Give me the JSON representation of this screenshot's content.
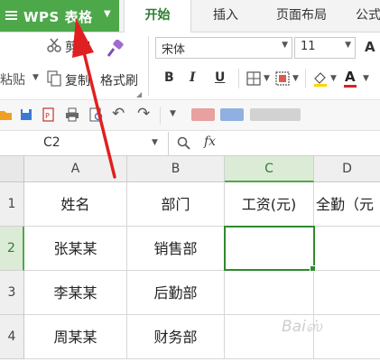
{
  "app": {
    "title": "WPS 表格"
  },
  "tabs": [
    "开始",
    "插入",
    "页面布局",
    "公式"
  ],
  "ribbon": {
    "cut": "剪切",
    "paste": "粘贴",
    "copy": "复制",
    "format_painter": "格式刷",
    "font_name": "宋体",
    "font_size": "11",
    "bold": "B",
    "italic": "I",
    "underline": "U",
    "font_color_letter": "A"
  },
  "formula_bar": {
    "cell_ref": "C2",
    "fx": "fx",
    "value": ""
  },
  "columns": [
    "A",
    "B",
    "C",
    "D"
  ],
  "rows": [
    {
      "num": "1",
      "cells": [
        "姓名",
        "部门",
        "工资(元)",
        "全勤（元"
      ]
    },
    {
      "num": "2",
      "cells": [
        "张某某",
        "销售部",
        "",
        ""
      ]
    },
    {
      "num": "3",
      "cells": [
        "李某某",
        "后勤部",
        "",
        ""
      ]
    },
    {
      "num": "4",
      "cells": [
        "周某某",
        "财务部",
        "",
        ""
      ]
    }
  ],
  "colors": {
    "accent": "#4da84a",
    "selection": "#2e8b2e",
    "arrow": "#e02020"
  }
}
